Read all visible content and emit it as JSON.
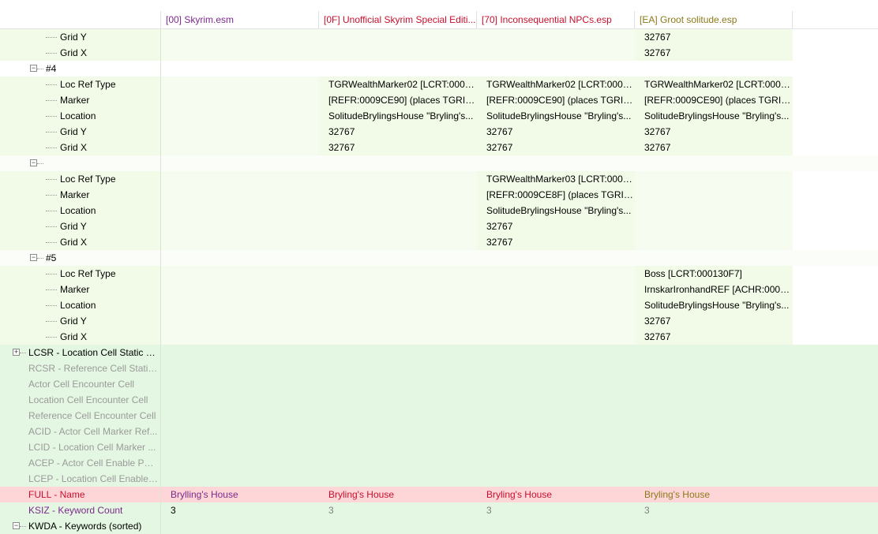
{
  "columns": [
    {
      "label": "",
      "color": "#000000"
    },
    {
      "label": "[00] Skyrim.esm",
      "color": "#7b2a8c"
    },
    {
      "label": "[0F] Unofficial Skyrim Special Editi...",
      "color": "#c8102e"
    },
    {
      "label": "[70] Inconsequential NPCs.esp",
      "color": "#c8102e"
    },
    {
      "label": "[EA] Groot solitude.esp",
      "color": "#8a7a1a"
    },
    {
      "label": "",
      "color": "#000000"
    }
  ],
  "colors": {
    "green_bg": "#f2fbe8",
    "green_bg_alt": "#eaf8e0",
    "section_bg": "#e4f7e2",
    "row_white": "#fbfdf8",
    "header_row": "#ffd6d8",
    "conflict_text": "#c8102e",
    "purple_text": "#7b2a8c",
    "gray_text": "#9a9a9a",
    "brown_text": "#8a7a1a"
  },
  "rows": [
    {
      "indent": 76,
      "label": "Grid Y",
      "values": [
        "",
        "",
        "",
        "32767"
      ],
      "bg": "#f2fbe8",
      "text": "#000000"
    },
    {
      "indent": 76,
      "label": "Grid X",
      "values": [
        "",
        "",
        "",
        "32767"
      ],
      "bg": "#f2fbe8",
      "text": "#000000"
    },
    {
      "indent": 58,
      "label": "#4",
      "toggle": "−",
      "values": [
        "",
        "",
        "",
        ""
      ],
      "bg": "#ffffff",
      "text": "#000000"
    },
    {
      "indent": 76,
      "label": "Loc Ref Type",
      "values": [
        "",
        "TGRWealthMarker02 [LCRT:0001...",
        "TGRWealthMarker02 [LCRT:0001...",
        "TGRWealthMarker02 [LCRT:0001..."
      ],
      "bg": "#f2fbe8",
      "text": "#000000"
    },
    {
      "indent": 76,
      "label": "Marker",
      "values": [
        "",
        "[REFR:0009CE90] (places TGRIte...",
        "[REFR:0009CE90] (places TGRIte...",
        "[REFR:0009CE90] (places TGRIte..."
      ],
      "bg": "#f2fbe8",
      "text": "#000000"
    },
    {
      "indent": 76,
      "label": "Location",
      "values": [
        "",
        "SolitudeBrylingsHouse \"Bryling's...",
        "SolitudeBrylingsHouse \"Bryling's...",
        "SolitudeBrylingsHouse \"Bryling's..."
      ],
      "bg": "#f2fbe8",
      "text": "#000000"
    },
    {
      "indent": 76,
      "label": "Grid Y",
      "values": [
        "",
        "32767",
        "32767",
        "32767"
      ],
      "bg": "#f2fbe8",
      "text": "#000000"
    },
    {
      "indent": 76,
      "label": "Grid X",
      "values": [
        "",
        "32767",
        "32767",
        "32767"
      ],
      "bg": "#f2fbe8",
      "text": "#000000"
    },
    {
      "indent": 58,
      "label": "",
      "toggle": "−",
      "values": [
        "",
        "",
        "",
        ""
      ],
      "bg": "#fbfdf8",
      "text": "#000000"
    },
    {
      "indent": 76,
      "label": "Loc Ref Type",
      "values": [
        "",
        "",
        "TGRWealthMarker03 [LCRT:0001...",
        ""
      ],
      "bg": "#f2fbe8",
      "text": "#000000"
    },
    {
      "indent": 76,
      "label": "Marker",
      "values": [
        "",
        "",
        "[REFR:0009CE8F] (places TGRIte...",
        ""
      ],
      "bg": "#f2fbe8",
      "text": "#000000"
    },
    {
      "indent": 76,
      "label": "Location",
      "values": [
        "",
        "",
        "SolitudeBrylingsHouse \"Bryling's...",
        ""
      ],
      "bg": "#f2fbe8",
      "text": "#000000"
    },
    {
      "indent": 76,
      "label": "Grid Y",
      "values": [
        "",
        "",
        "32767",
        ""
      ],
      "bg": "#f2fbe8",
      "text": "#000000"
    },
    {
      "indent": 76,
      "label": "Grid X",
      "values": [
        "",
        "",
        "32767",
        ""
      ],
      "bg": "#f2fbe8",
      "text": "#000000"
    },
    {
      "indent": 58,
      "label": "#5",
      "toggle": "−",
      "values": [
        "",
        "",
        "",
        ""
      ],
      "bg": "#fbfdf8",
      "text": "#000000"
    },
    {
      "indent": 76,
      "label": "Loc Ref Type",
      "values": [
        "",
        "",
        "",
        "Boss [LCRT:000130F7]"
      ],
      "bg": "#f2fbe8",
      "text": "#000000"
    },
    {
      "indent": 76,
      "label": "Marker",
      "values": [
        "",
        "",
        "",
        "IrnskarIronhandREF [ACHR:0001..."
      ],
      "bg": "#f2fbe8",
      "text": "#000000"
    },
    {
      "indent": 76,
      "label": "Location",
      "values": [
        "",
        "",
        "",
        "SolitudeBrylingsHouse \"Bryling's..."
      ],
      "bg": "#f2fbe8",
      "text": "#000000"
    },
    {
      "indent": 76,
      "label": "Grid Y",
      "values": [
        "",
        "",
        "",
        "32767"
      ],
      "bg": "#f2fbe8",
      "text": "#000000"
    },
    {
      "indent": 76,
      "label": "Grid X",
      "values": [
        "",
        "",
        "",
        "32767"
      ],
      "bg": "#f2fbe8",
      "text": "#000000"
    },
    {
      "indent": 36,
      "label": "LCSR - Location Cell Static R...",
      "toggle": "+",
      "values": [
        "",
        "",
        "",
        ""
      ],
      "bg": "#e4f7e2",
      "text": "#000000"
    },
    {
      "indent": 36,
      "label": "RCSR - Reference Cell Static ...",
      "values": [
        "",
        "",
        "",
        ""
      ],
      "bg": "#e4f7e2",
      "text": "#9a9a9a"
    },
    {
      "indent": 36,
      "label": "Actor Cell Encounter Cell",
      "values": [
        "",
        "",
        "",
        ""
      ],
      "bg": "#e4f7e2",
      "text": "#9a9a9a"
    },
    {
      "indent": 36,
      "label": "Location Cell Encounter Cell",
      "values": [
        "",
        "",
        "",
        ""
      ],
      "bg": "#e4f7e2",
      "text": "#9a9a9a"
    },
    {
      "indent": 36,
      "label": "Reference Cell Encounter Cell",
      "values": [
        "",
        "",
        "",
        ""
      ],
      "bg": "#e4f7e2",
      "text": "#9a9a9a"
    },
    {
      "indent": 36,
      "label": "ACID - Actor Cell Marker Ref...",
      "values": [
        "",
        "",
        "",
        ""
      ],
      "bg": "#e4f7e2",
      "text": "#9a9a9a"
    },
    {
      "indent": 36,
      "label": "LCID - Location Cell Marker ...",
      "values": [
        "",
        "",
        "",
        ""
      ],
      "bg": "#e4f7e2",
      "text": "#9a9a9a"
    },
    {
      "indent": 36,
      "label": "ACEP - Actor Cell Enable Point",
      "values": [
        "",
        "",
        "",
        ""
      ],
      "bg": "#e4f7e2",
      "text": "#9a9a9a"
    },
    {
      "indent": 36,
      "label": "LCEP - Location Cell Enable ...",
      "values": [
        "",
        "",
        "",
        ""
      ],
      "bg": "#e4f7e2",
      "text": "#9a9a9a"
    },
    {
      "indent": 36,
      "label": "FULL - Name",
      "values": [
        "Brylling's House",
        "Bryling's House",
        "Bryling's House",
        "Bryling's House"
      ],
      "bg": "#ffd6d8",
      "text": "#c8102e",
      "valueColors": [
        "#7b2a8c",
        "#c8102e",
        "#c8102e",
        "#8a7a1a"
      ]
    },
    {
      "indent": 36,
      "label": "KSIZ - Keyword Count",
      "values": [
        "3",
        "3",
        "3",
        "3"
      ],
      "bg": "#e4f7e2",
      "text": "#7b2a8c",
      "valueColors": [
        "#000000",
        "#808080",
        "#808080",
        "#808080"
      ]
    },
    {
      "indent": 36,
      "label": "KWDA - Keywords (sorted)",
      "toggle": "−",
      "values": [
        "",
        "",
        "",
        ""
      ],
      "bg": "#e4f7e2",
      "text": "#000000"
    }
  ]
}
